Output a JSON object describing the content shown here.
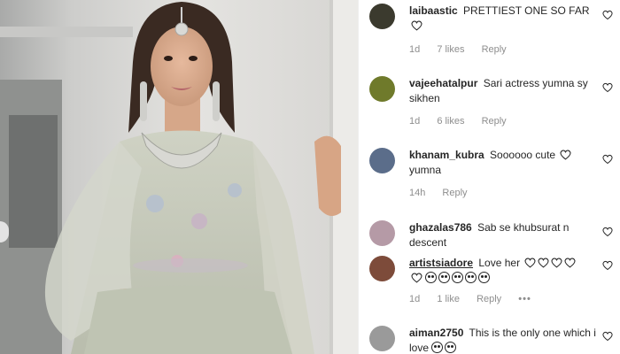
{
  "post": {
    "photo_description_icon": "portrait-photo",
    "colors": {
      "dress": "#c9cdbe",
      "background": "#dddcd8",
      "hair": "#3a2a22"
    }
  },
  "icons": {
    "like": "heart-outline-icon",
    "more": "ellipsis-icon",
    "emoji": "heart-eyes-emoji"
  },
  "comments": [
    {
      "username": "laibaastic",
      "text": "PRETTIEST ONE SO FAR",
      "inline_heart": true,
      "time": "1d",
      "likes": "7 likes",
      "reply": "Reply",
      "avatar_color": "#3b3a2e"
    },
    {
      "username": "vajeehatalpur",
      "text": "Sari actress yumna sy sikhen",
      "time": "1d",
      "likes": "6 likes",
      "reply": "Reply",
      "avatar_color": "#6f7a2b"
    },
    {
      "username": "khanam_kubra",
      "text_before": "Soooooo cute",
      "text_after": "yumna",
      "time": "14h",
      "reply": "Reply",
      "avatar_color": "#5b6d8a"
    },
    {
      "username": "ghazalas786",
      "text": "Sab se khubsurat n descent",
      "avatar_color": "#b59aa6"
    },
    {
      "username": "artistsiadore",
      "text": "Love her",
      "time": "1d",
      "likes": "1 like",
      "reply": "Reply",
      "more": "•••",
      "avatar_color": "#7d4b3a"
    },
    {
      "username": "aiman2750",
      "text": "This is the only one which i love",
      "avatar_color": "#9a9a9a"
    }
  ]
}
